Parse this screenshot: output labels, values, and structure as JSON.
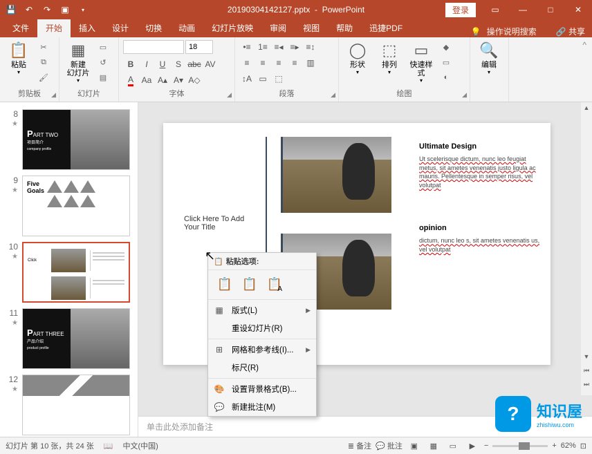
{
  "title": {
    "filename": "20190304142127.pptx",
    "app": "PowerPoint",
    "login": "登录"
  },
  "tabs": {
    "file": "文件",
    "home": "开始",
    "insert": "插入",
    "design": "设计",
    "transitions": "切换",
    "animations": "动画",
    "slideshow": "幻灯片放映",
    "review": "审阅",
    "view": "视图",
    "help": "帮助",
    "xunjie": "迅捷PDF",
    "tellme": "操作说明搜索",
    "share": "共享"
  },
  "ribbon": {
    "clipboard": {
      "label": "剪贴板",
      "paste": "粘贴"
    },
    "slides": {
      "label": "幻灯片",
      "newSlide": "新建\n幻灯片"
    },
    "font": {
      "label": "字体",
      "sizeValue": "18"
    },
    "paragraph": {
      "label": "段落"
    },
    "drawing": {
      "label": "绘图",
      "shapes": "形状",
      "arrange": "排列",
      "quickStyles": "快速样式"
    },
    "editing": {
      "label": "编辑"
    }
  },
  "thumbs": {
    "n8": "8",
    "t8_part": "P",
    "t8_rest": "ART TWO",
    "t8_sub1": "项目简介",
    "t8_sub2": "company profile",
    "n9": "9",
    "t9_label": "Five\nGoals",
    "n10": "10",
    "n11": "11",
    "t11_part": "P",
    "t11_rest": "ART THREE",
    "t11_sub1": "产品介绍",
    "t11_sub2": "product profile",
    "n12": "12"
  },
  "slide": {
    "titlePlaceholder": "Click Here To Add Your Title",
    "h1": "Ultimate Design",
    "p1": "Ut scelerisque dictum, nunc leo feugiat metus, sit ametes venenatis justo ligula ac mauris. Pellentesque in semper risus, vel volutpat",
    "h2": "opinion",
    "p2": "dictum, nunc leo s, sit ametes venenatis us, vel volutpat"
  },
  "contextMenu": {
    "header": "粘贴选项:",
    "layout": "版式(L)",
    "reset": "重设幻灯片(R)",
    "grid": "网格和参考线(I)...",
    "ruler": "标尺(R)",
    "formatBg": "设置背景格式(B)...",
    "newComment": "新建批注(M)"
  },
  "notes": {
    "placeholder": "单击此处添加备注"
  },
  "status": {
    "slideCount": "幻灯片 第 10 张，共 24 张",
    "lang": "中文(中国)",
    "notes": "备注",
    "comments": "批注",
    "zoom": "62%"
  },
  "watermark": {
    "text": "知识屋",
    "url": "zhishiwu.com"
  }
}
